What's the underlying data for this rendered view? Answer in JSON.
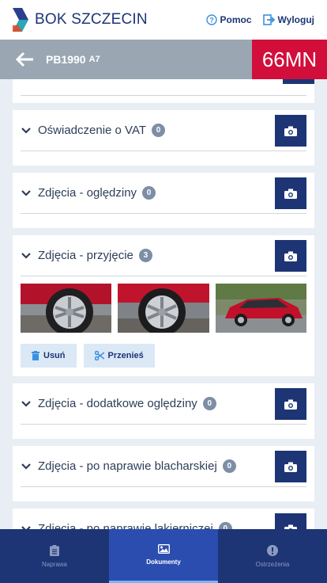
{
  "header": {
    "title": "BOK SZCZECIN",
    "help_label": "Pomoc",
    "logout_label": "Wyloguj"
  },
  "vehicle": {
    "plate": "PB1990",
    "plate_sub": "A7",
    "badge": "66MN"
  },
  "sections": [
    {
      "title": "Oświadczenie o VAT",
      "count": "0"
    },
    {
      "title": "Zdjęcia - oględziny",
      "count": "0"
    },
    {
      "title": "Zdjęcia - przyjęcie",
      "count": "3"
    },
    {
      "title": "Zdjęcia - dodatkowe oględziny",
      "count": "0"
    },
    {
      "title": "Zdjęcia - po naprawie blacharskiej",
      "count": "0"
    },
    {
      "title": "Zdjęcia - po naprawie lakierniczej",
      "count": "0"
    }
  ],
  "actions": {
    "delete_label": "Usuń",
    "move_label": "Przenieś"
  },
  "nav": {
    "items": [
      {
        "label": "Naprawa",
        "icon": "clipboard-icon"
      },
      {
        "label": "Dokumenty",
        "icon": "image-icon"
      },
      {
        "label": "Ostrzeżenia",
        "icon": "warning-icon"
      }
    ],
    "active": "Dokumenty"
  },
  "colors": {
    "primary": "#1d3575",
    "accent_red": "#d20e3a",
    "subheader": "#9aa7b2",
    "nav_active": "#2b4db0"
  }
}
